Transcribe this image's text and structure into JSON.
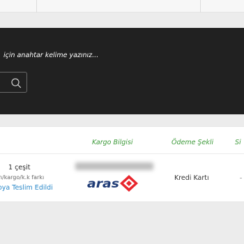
{
  "search": {
    "hint": "için anahtar kelime yazınız..."
  },
  "orders": {
    "columns": {
      "shipping_info": "Kargo Bilgisi",
      "payment_method": "Ödeme Şekli",
      "next_partial": "Si"
    },
    "row": {
      "quantity": "1 çeşit",
      "note": "n/kargo/k.k farkı",
      "status": "oya Teslim Edildi",
      "carrier_logo_text": "aras",
      "payment": "Kredi Kartı"
    }
  },
  "colors": {
    "search_panel": "#212121",
    "column_header": "#3d9a3a",
    "status_link": "#2a88c9",
    "carrier_brand": "#e8262d",
    "carrier_text": "#1f3b75"
  },
  "icons": {
    "search": "search-icon",
    "carrier": "aras-kargo-logo"
  }
}
